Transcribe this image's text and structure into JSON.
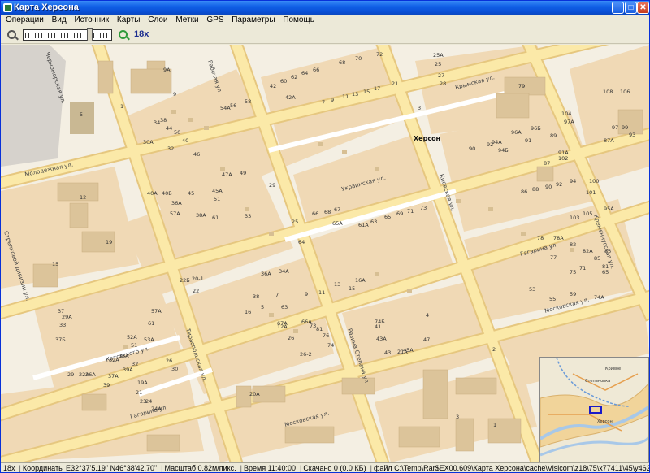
{
  "window": {
    "title": "Карта Херсона",
    "icon": "map-app-icon",
    "controls": [
      "minimize-icon",
      "maximize-icon",
      "close-icon"
    ]
  },
  "menu": [
    "Операции",
    "Вид",
    "Источник",
    "Карты",
    "Слои",
    "Метки",
    "GPS",
    "Параметры",
    "Помощь"
  ],
  "toolbar": {
    "zoom_out_icon": "magnifier-minus-icon",
    "zoom_in_icon": "magnifier-plus-icon",
    "zoom_level": "18x",
    "zoom_fraction": 0.77
  },
  "map": {
    "city_label": "Херсон",
    "streets": [
      "Молодежная ул.",
      "Крымская ул.",
      "Украинская ул.",
      "Киевская ул.",
      "Гагарина ул.",
      "Московская ул.",
      "Котовского ул.",
      "Тираспольская ул.",
      "Рабочая ул.",
      "Черноморская ул.",
      "Стрелковой дивизии ул.",
      "Разина Степана ул.",
      "Гагарина ул.",
      "Московская ул.",
      "Кременчугская ул."
    ],
    "house_numbers": [
      "9A",
      "9",
      "5",
      "1",
      "12",
      "19",
      "15",
      "68",
      "70",
      "72",
      "42",
      "60",
      "62",
      "64",
      "66",
      "42A",
      "7",
      "9",
      "11",
      "13",
      "15",
      "17",
      "21",
      "25A",
      "25",
      "27",
      "28",
      "3",
      "79",
      "108",
      "106",
      "54A",
      "56",
      "58",
      "38",
      "44",
      "50",
      "30A",
      "34",
      "32",
      "40",
      "46",
      "47A",
      "49",
      "40A",
      "40Б",
      "45",
      "45A",
      "51",
      "38A",
      "36A",
      "57A",
      "61",
      "33",
      "29",
      "25",
      "64",
      "66",
      "68",
      "67",
      "65A",
      "61A",
      "63",
      "65",
      "69",
      "71",
      "73",
      "96A",
      "96Б",
      "94A",
      "94Б",
      "90",
      "92",
      "91",
      "89",
      "102",
      "104",
      "97A",
      "97",
      "99",
      "93",
      "87A",
      "87",
      "91A",
      "86",
      "88",
      "90",
      "92",
      "94",
      "100",
      "101",
      "103",
      "105",
      "95A",
      "74A",
      "78",
      "78A",
      "82",
      "82A",
      "83",
      "85",
      "81",
      "77",
      "75",
      "71",
      "65",
      "59",
      "55",
      "53",
      "47",
      "45A",
      "43",
      "43A",
      "41",
      "34A",
      "36A",
      "38",
      "16",
      "16A",
      "15",
      "13",
      "11",
      "9",
      "7",
      "5",
      "12A",
      "26",
      "26-2",
      "20A",
      "20-1",
      "22",
      "22Б",
      "22A",
      "26A",
      "29",
      "29A",
      "33",
      "37",
      "37Б",
      "37A",
      "39",
      "39A",
      "19A",
      "21",
      "23",
      "24",
      "24A",
      "26",
      "30",
      "32",
      "32A",
      "33A",
      "51",
      "52A",
      "53A",
      "57A",
      "61",
      "63",
      "67A",
      "66A",
      "73",
      "81",
      "76",
      "74",
      "74Б",
      "21A",
      "4",
      "2",
      "3",
      "1"
    ],
    "overview": {
      "label": "Херсон",
      "places": [
        "Степановка",
        "Кривое"
      ]
    }
  },
  "status": {
    "zoom": "18x",
    "coords": "Координаты E32°37'5.19\" N46°38'42.70\"",
    "scale": "Масштаб 0.82м/пикс.",
    "time": "Время 11:40:00",
    "downloaded": "Скачано 0 (0.0 КБ)",
    "file": "файл C:\\Temp\\Rar$EX00.609\\Карта Херсона\\cache\\Visicom\\z18\\75\\x77411\\45\\y46290.png"
  },
  "colors": {
    "map_bg": "#f4efe3",
    "block": "#f0d9b5",
    "road": "#fbe9a8",
    "road_edge": "#e6c77f",
    "building": "#dcc49a",
    "title_blue": "#0a4fd6"
  }
}
